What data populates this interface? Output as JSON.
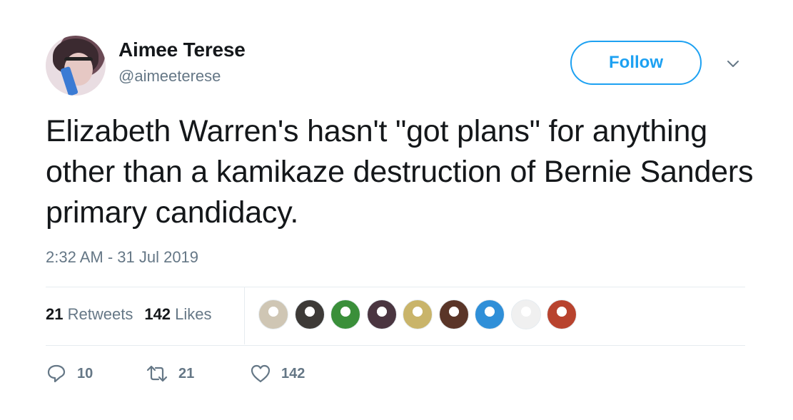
{
  "author": {
    "name": "Aimee Terese",
    "handle": "@aimeeterese"
  },
  "follow_label": "Follow",
  "tweet": {
    "text": "Elizabeth Warren's hasn't \"got plans\" for anything other than a kamikaze destruction of Bernie Sanders primary candidacy.",
    "timestamp": "2:32 AM - 31 Jul 2019"
  },
  "stats": {
    "retweets_count": "21",
    "retweets_label": "Retweets",
    "likes_count": "142",
    "likes_label": "Likes"
  },
  "liker_avatars": [
    {
      "name": "liker-avatar-1",
      "color": "#cfc6b4"
    },
    {
      "name": "liker-avatar-2",
      "color": "#3d3a37"
    },
    {
      "name": "liker-avatar-3",
      "color": "#3a8f3a"
    },
    {
      "name": "liker-avatar-4",
      "color": "#4a3540"
    },
    {
      "name": "liker-avatar-5",
      "color": "#c9b46a"
    },
    {
      "name": "liker-avatar-6",
      "color": "#5a3528"
    },
    {
      "name": "liker-avatar-7",
      "color": "#2f8fd8"
    },
    {
      "name": "liker-avatar-8",
      "color": "#f0f0f0"
    },
    {
      "name": "liker-avatar-9",
      "color": "#b8432e"
    }
  ],
  "actions": {
    "reply_count": "10",
    "retweet_count": "21",
    "like_count": "142"
  },
  "colors": {
    "accent": "#1da1f2",
    "text": "#14171a",
    "secondary": "#657786",
    "divider": "#e6ecf0"
  },
  "icons": {
    "more": "chevron-down-icon",
    "reply": "reply-icon",
    "retweet": "retweet-icon",
    "like": "heart-icon"
  }
}
